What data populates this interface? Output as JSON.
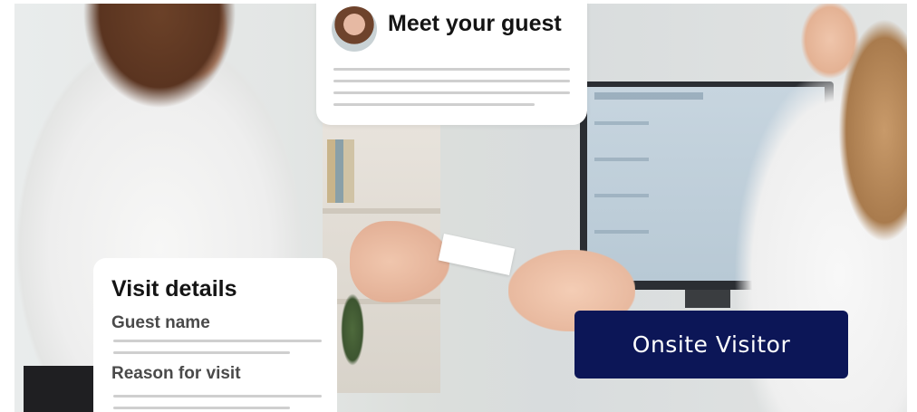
{
  "meet_card": {
    "title": "Meet your guest",
    "avatar_icon": "guest-avatar"
  },
  "visit_details": {
    "title": "Visit details",
    "fields": [
      {
        "label": "Guest name"
      },
      {
        "label": "Reason for visit"
      }
    ]
  },
  "badge": {
    "label": "Onsite Visitor",
    "color": "#0c1657"
  }
}
